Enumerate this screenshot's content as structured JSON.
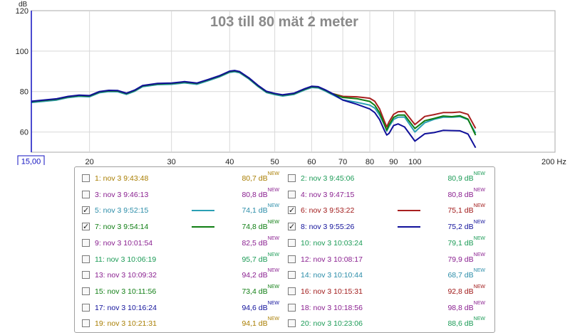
{
  "chart_data": {
    "type": "line",
    "title": "103 till 80  mät 2 meter",
    "ylabel": "dB",
    "xunit": "Hz",
    "xscale": "log",
    "xlim": [
      15,
      200
    ],
    "ylim": [
      50,
      120
    ],
    "yticks": [
      60,
      80,
      100,
      120
    ],
    "xtick_labels": [
      "20",
      "30",
      "40",
      "50",
      "60",
      "70",
      "80",
      "90",
      "100",
      "200 Hz"
    ],
    "x_start_label": "15,00",
    "grid": true,
    "series": [
      {
        "name": "5: nov 3 9:52:15",
        "color": "#2a9fb4",
        "x": [
          15,
          17,
          18,
          19,
          20,
          21,
          22,
          23,
          24,
          25,
          26,
          28,
          30,
          32,
          34,
          36,
          38,
          40,
          41,
          42,
          44,
          46,
          48,
          50,
          52,
          55,
          58,
          60,
          62,
          64,
          66,
          70,
          75,
          80,
          82,
          84,
          86,
          87,
          88,
          90,
          92,
          95,
          100,
          105,
          110,
          115,
          120,
          125,
          130,
          135
        ],
        "y": [
          74.6,
          75.8,
          77,
          77.6,
          77.4,
          79.4,
          80,
          79.9,
          78.6,
          80.1,
          82.4,
          83.4,
          83.6,
          84.3,
          83.6,
          85.4,
          87.2,
          89.5,
          89.8,
          89.3,
          86.2,
          82.5,
          79.5,
          78.5,
          77.8,
          78.6,
          80.8,
          82,
          81.8,
          80.4,
          78.8,
          75.9,
          74.7,
          73.3,
          71.8,
          68.3,
          63.6,
          60.5,
          62.7,
          66.2,
          67.3,
          67.4,
          60,
          64.6,
          66.3,
          67.3,
          67.3,
          67.6,
          66.1,
          59.4
        ]
      },
      {
        "name": "6: nov 3 9:53:22",
        "color": "#a82020",
        "x": [
          15,
          17,
          18,
          19,
          20,
          21,
          22,
          23,
          24,
          25,
          26,
          28,
          30,
          32,
          34,
          36,
          38,
          40,
          41,
          42,
          44,
          46,
          48,
          50,
          52,
          55,
          58,
          60,
          62,
          64,
          66,
          70,
          75,
          80,
          82,
          84,
          86,
          87,
          88,
          90,
          92,
          95,
          100,
          105,
          110,
          115,
          120,
          125,
          130,
          135
        ],
        "y": [
          75,
          76.2,
          77.4,
          78,
          77.8,
          79.8,
          80.4,
          80.3,
          79,
          80.5,
          82.8,
          83.8,
          84,
          84.7,
          84,
          85.8,
          87.6,
          89.9,
          90.2,
          89.7,
          86.6,
          82.9,
          79.9,
          78.9,
          78.2,
          79,
          81.2,
          82.4,
          82.2,
          80.8,
          79.2,
          77.6,
          77.4,
          76.7,
          75.2,
          71.4,
          65.3,
          62.5,
          65,
          68.7,
          70,
          70.2,
          63.7,
          67.7,
          68.6,
          69.6,
          69.6,
          69.9,
          68.7,
          61.8
        ]
      },
      {
        "name": "7: nov 3 9:54:14",
        "color": "#0e7d12",
        "x": [
          15,
          17,
          18,
          19,
          20,
          21,
          22,
          23,
          24,
          25,
          26,
          28,
          30,
          32,
          34,
          36,
          38,
          40,
          41,
          42,
          44,
          46,
          48,
          50,
          52,
          55,
          58,
          60,
          62,
          64,
          66,
          70,
          75,
          80,
          82,
          84,
          86,
          87,
          88,
          90,
          92,
          95,
          100,
          105,
          110,
          115,
          120,
          125,
          130,
          135
        ],
        "y": [
          75,
          76.2,
          77.4,
          78,
          77.8,
          79.8,
          80.4,
          80.3,
          79,
          80.5,
          82.8,
          83.8,
          84,
          84.7,
          84,
          85.8,
          87.6,
          89.9,
          90.2,
          89.7,
          86.6,
          82.9,
          79.9,
          78.9,
          78.2,
          79,
          81.2,
          82.4,
          82.2,
          80.8,
          79.2,
          77.1,
          76.5,
          75.1,
          73.2,
          69.5,
          63.6,
          60.9,
          63.5,
          67.2,
          68.4,
          68.4,
          61.7,
          65.6,
          66.7,
          67.9,
          67.6,
          68,
          66.4,
          58.4
        ]
      },
      {
        "name": "8: nov 3 9:55:26",
        "color": "#10109a",
        "x": [
          15,
          17,
          18,
          19,
          20,
          21,
          22,
          23,
          24,
          25,
          26,
          28,
          30,
          32,
          34,
          36,
          38,
          40,
          41,
          42,
          44,
          46,
          48,
          50,
          52,
          55,
          58,
          60,
          62,
          64,
          66,
          70,
          75,
          80,
          82,
          84,
          86,
          87,
          88,
          90,
          92,
          95,
          100,
          105,
          110,
          115,
          120,
          125,
          130,
          135
        ],
        "y": [
          75.2,
          76.4,
          77.6,
          78.2,
          78,
          80,
          80.6,
          80.5,
          79.2,
          80.7,
          83,
          84,
          84.2,
          84.9,
          84.2,
          86,
          87.8,
          90.1,
          90.4,
          89.9,
          86.8,
          83.1,
          80.1,
          79.1,
          78.4,
          79.2,
          81.4,
          82.6,
          82.4,
          81,
          79.4,
          75.8,
          73.7,
          71.4,
          69.6,
          66.1,
          60.8,
          58.5,
          59.3,
          63.2,
          64,
          62.5,
          55.5,
          59.1,
          59.7,
          60.8,
          60.7,
          60.6,
          59,
          52.2
        ]
      }
    ]
  },
  "legend": [
    {
      "label": "1: nov 3 9:43:48",
      "value": "80,7 dB",
      "checked": false,
      "color": "#a87d00"
    },
    {
      "label": "2: nov 3 9:45:06",
      "value": "80,9 dB",
      "checked": false,
      "color": "#1a9a55"
    },
    {
      "label": "3: nov 3 9:46:13",
      "value": "80,8 dB",
      "checked": false,
      "color": "#8a2090"
    },
    {
      "label": "4: nov 3 9:47:15",
      "value": "80,8 dB",
      "checked": false,
      "color": "#8a2090"
    },
    {
      "label": "5: nov 3 9:52:15",
      "value": "74,1 dB",
      "checked": true,
      "color": "#2a8ca8",
      "line": "#2a9fb4"
    },
    {
      "label": "6: nov 3 9:53:22",
      "value": "75,1 dB",
      "checked": true,
      "color": "#a01818",
      "line": "#a82020"
    },
    {
      "label": "7: nov 3 9:54:14",
      "value": "74,8 dB",
      "checked": true,
      "color": "#0e7d12",
      "line": "#0e7d12"
    },
    {
      "label": "8: nov 3 9:55:26",
      "value": "75,2 dB",
      "checked": true,
      "color": "#10109a",
      "line": "#10109a"
    },
    {
      "label": "9: nov 3 10:01:54",
      "value": "82,5 dB",
      "checked": false,
      "color": "#8a2090"
    },
    {
      "label": "10: nov 3 10:03:24",
      "value": "79,1 dB",
      "checked": false,
      "color": "#1a9a55"
    },
    {
      "label": "11: nov 3 10:06:19",
      "value": "95,7 dB",
      "checked": false,
      "color": "#1a9a55"
    },
    {
      "label": "12: nov 3 10:08:17",
      "value": "79,9 dB",
      "checked": false,
      "color": "#8a2090"
    },
    {
      "label": "13: nov 3 10:09:32",
      "value": "94,2 dB",
      "checked": false,
      "color": "#8a2090"
    },
    {
      "label": "14: nov 3 10:10:44",
      "value": "68,7 dB",
      "checked": false,
      "color": "#2a8ca8"
    },
    {
      "label": "15: nov 3 10:11:56",
      "value": "73,4 dB",
      "checked": false,
      "color": "#0e7d12"
    },
    {
      "label": "16: nov 3 10:15:31",
      "value": "92,8 dB",
      "checked": false,
      "color": "#a01818"
    },
    {
      "label": "17: nov 3 10:16:24",
      "value": "94,6 dB",
      "checked": false,
      "color": "#10109a"
    },
    {
      "label": "18: nov 3 10:18:56",
      "value": "98,8 dB",
      "checked": false,
      "color": "#8a2090"
    },
    {
      "label": "19: nov 3 10:21:31",
      "value": "94,1 dB",
      "checked": false,
      "color": "#a87d00"
    },
    {
      "label": "20: nov 3 10:23:06",
      "value": "88,6 dB",
      "checked": false,
      "color": "#1a9a55"
    }
  ],
  "legend_sup": "NEW"
}
